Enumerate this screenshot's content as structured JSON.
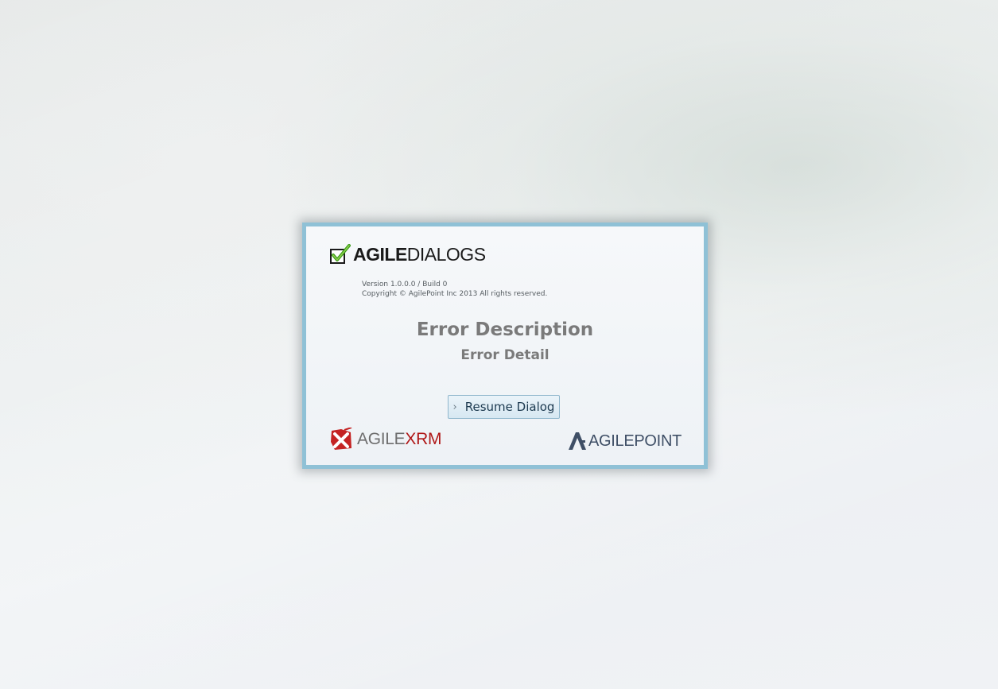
{
  "brand": {
    "logo_strong": "AGILE",
    "logo_light": "DIALOGS"
  },
  "about": {
    "version": "Version 1.0.0.0 / Build 0",
    "copyright": "Copyright © AgilePoint Inc 2013 All rights reserved."
  },
  "error": {
    "description": "Error Description",
    "detail": "Error Detail"
  },
  "actions": {
    "resume_label": "Resume Dialog",
    "resume_icon": "chevron-right-icon"
  },
  "footer": {
    "xrm_logo_a": "AGILE",
    "xrm_logo_b": "XRM",
    "agilepoint_logo": "AGILEPOINT"
  },
  "colors": {
    "dialog_border": "#8fc1d6",
    "button_border": "#8fb6cc",
    "heading_text": "#7a7a7a",
    "checkmark_green": "#3c9c1a",
    "xrm_red": "#b01818",
    "agilepoint_slate": "#3f4f66"
  }
}
